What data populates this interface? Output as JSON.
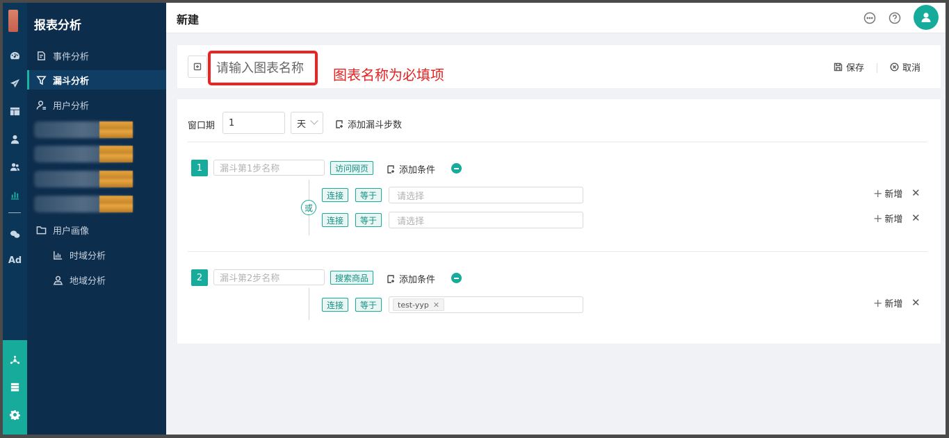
{
  "sidebar": {
    "title": "报表分析",
    "items": [
      {
        "label": "事件分析"
      },
      {
        "label": "漏斗分析"
      },
      {
        "label": "用户分析"
      },
      {
        "label": "用户画像"
      },
      {
        "label": "时域分析"
      },
      {
        "label": "地域分析"
      }
    ]
  },
  "rail": {
    "ad_label": "Ad"
  },
  "header": {
    "title": "新建"
  },
  "chart_name": {
    "placeholder": "请输入图表名称",
    "annotation": "图表名称为必填项",
    "save_label": "保存",
    "cancel_label": "取消"
  },
  "window": {
    "label": "窗口期",
    "value": "1",
    "unit": "天",
    "add_step_label": "添加漏斗步数"
  },
  "steps": [
    {
      "number": "1",
      "name_placeholder": "漏斗第1步名称",
      "event_tag": "访问网页",
      "add_condition_label": "添加条件",
      "or_label": "或",
      "conditions": [
        {
          "connector": "连接",
          "operator": "等于",
          "placeholder": "请选择",
          "add_label": "新增"
        },
        {
          "connector": "连接",
          "operator": "等于",
          "placeholder": "请选择",
          "add_label": "新增"
        }
      ]
    },
    {
      "number": "2",
      "name_placeholder": "漏斗第2步名称",
      "event_tag": "搜索商品",
      "add_condition_label": "添加条件",
      "conditions": [
        {
          "connector": "连接",
          "operator": "等于",
          "chip": "test-yyp",
          "add_label": "新增"
        }
      ]
    }
  ],
  "colors": {
    "accent": "#16ab9b",
    "sidebar_bg": "#0d2d4d",
    "rail_bg": "#0c3657",
    "warning_red": "#ee2222"
  }
}
